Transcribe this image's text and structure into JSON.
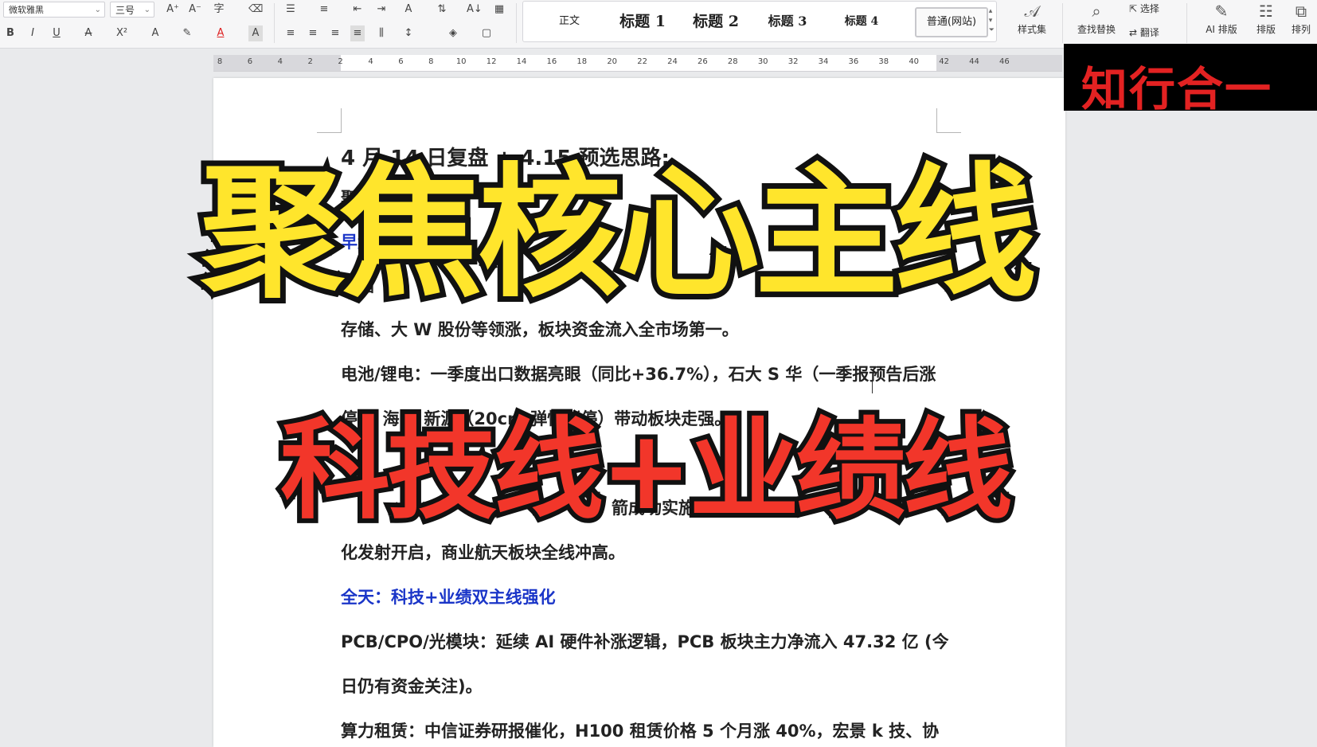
{
  "ribbon": {
    "font_name": "微软雅黑",
    "font_size": "三号",
    "styles": [
      "正文",
      "标题 1",
      "标题 2",
      "标题 3",
      "标题 4",
      "普通(网站)"
    ],
    "style_gallery_label": "样式集",
    "find_replace": "查找替换",
    "select": "选择",
    "translate": "翻译",
    "ai_layout": "AI 排版",
    "layout": "排版",
    "arrange": "排列"
  },
  "ruler": [
    "8",
    "6",
    "4",
    "2",
    "2",
    "4",
    "6",
    "8",
    "10",
    "12",
    "14",
    "16",
    "18",
    "20",
    "22",
    "24",
    "26",
    "28",
    "30",
    "32",
    "34",
    "36",
    "38",
    "40",
    "42",
    "44",
    "46"
  ],
  "document": {
    "title": "4 月 14 日复盘 + 4.15 预选思路:",
    "line2": "聚焦核心主线",
    "line3": "早盘",
    "line4": "存储",
    "line5": "存储、大 W 股份等领涨，板块资金流入全市场第一。",
    "line6": "电池/锂电：一季度出口数据亮眼（同比+36.7%），石大 S 华（一季报预告后涨",
    "line7": "停）、海 K 新源（20cm 弹性涨停）带动板块走强。",
    "line8": "箭成功实施",
    "line9": "化发射开启，商业航天板块全线冲高。",
    "line10": "全天：科技+业绩双主线强化",
    "line11": "PCB/CPO/光模块：延续 AI 硬件补涨逻辑，PCB 板块主力净流入 47.32 亿 (今",
    "line12": "日仍有资金关注)。",
    "line13": "算力租赁：中信证券研报催化，H100 租赁价格 5 个月涨 40%，宏景 k 技、协"
  },
  "overlay": {
    "headline": "聚焦核心主线",
    "subheadline": "科技线+业绩线",
    "brand": "知行合一"
  },
  "colors": {
    "headline_fill": "#ffe52c",
    "subheadline_fill": "#f2362a",
    "brand_text": "#e32222",
    "blue_text": "#1a35c8"
  }
}
